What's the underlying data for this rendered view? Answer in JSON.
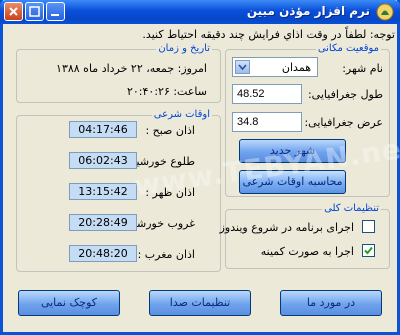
{
  "window": {
    "title": "نرم افزار مؤذن مبین"
  },
  "notice": "توجه: لطفاً در وقت اذاي فرايش چند دقيقه احتياط کنيد.",
  "location": {
    "legend": "موقعیت مکانی",
    "city_label": "نام شهر:",
    "city_value": "همدان",
    "longitude_label": "طول جغرافیایی:",
    "longitude_value": "48.52",
    "latitude_label": "عرض جغرافیایی:",
    "latitude_value": "34.8",
    "new_city_button": "شهر جدید",
    "calc_button": "محاسبه اوقات شرعی"
  },
  "datetime": {
    "legend": "تاریخ و زمان",
    "today": "امروز: جمعه، ۲۲ خرداد ماه ۱۳۸۸",
    "time": "ساعت: ۲۰:۴۰:۲۶"
  },
  "prayer": {
    "legend": "اوقات شرعی",
    "rows": [
      {
        "label": "اذان صبح :",
        "time": "04:17:46"
      },
      {
        "label": "طلوع خورشید :",
        "time": "06:02:43"
      },
      {
        "label": "اذان ظهر :",
        "time": "13:15:42"
      },
      {
        "label": "غروب خورشید :",
        "time": "20:28:49"
      },
      {
        "label": "اذان مغرب :",
        "time": "20:48:20"
      }
    ]
  },
  "general": {
    "legend": "تنظیمات کلی",
    "startup_label": "اجرای برنامه در شروع ویندوز",
    "startup_checked": false,
    "minimized_label": "اجرا به صورت کمینه",
    "minimized_checked": true
  },
  "footer": {
    "about_button": "در مورد ما",
    "sound_button": "تنظیمات صدا",
    "compact_button": "کوچک نمایی"
  },
  "watermark": "www.TEBYAN.net",
  "colors": {
    "accent": "#0046d5",
    "titlebar": "#0a4fd8",
    "time_field": "#c5dcf5"
  }
}
